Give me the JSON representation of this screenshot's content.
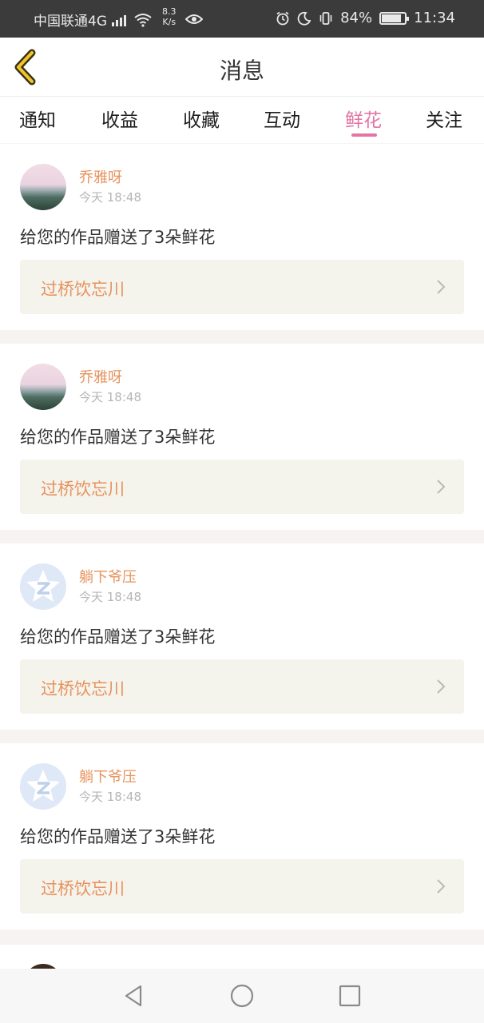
{
  "status_bar": {
    "carrier": "中国联通4G",
    "network_small": "4G",
    "speed_value": "8.3",
    "speed_unit": "K/s",
    "battery": "84%",
    "time": "11:34"
  },
  "header": {
    "title": "消息",
    "back_icon": "chevron-left-icon"
  },
  "tabs": [
    {
      "label": "通知",
      "active": false
    },
    {
      "label": "收益",
      "active": false
    },
    {
      "label": "收藏",
      "active": false
    },
    {
      "label": "互动",
      "active": false
    },
    {
      "label": "鲜花",
      "active": true
    },
    {
      "label": "关注",
      "active": false
    }
  ],
  "colors": {
    "accent_pink": "#e275a4",
    "name_orange": "#e7925c",
    "card_bg": "#f4f3ec"
  },
  "messages": [
    {
      "user": "乔雅呀",
      "time": "今天 18:48",
      "text": "给您的作品赠送了3朵鲜花",
      "work_title": "过桥饮忘川",
      "avatar": "landscape-avatar"
    },
    {
      "user": "乔雅呀",
      "time": "今天 18:48",
      "text": "给您的作品赠送了3朵鲜花",
      "work_title": "过桥饮忘川",
      "avatar": "landscape-avatar"
    },
    {
      "user": "躺下爷压",
      "time": "今天 18:48",
      "text": "给您的作品赠送了3朵鲜花",
      "work_title": "过桥饮忘川",
      "avatar": "star-logo-avatar"
    },
    {
      "user": "躺下爷压",
      "time": "今天 18:48",
      "text": "给您的作品赠送了3朵鲜花",
      "work_title": "过桥饮忘川",
      "avatar": "star-logo-avatar"
    }
  ],
  "nav_bar": {
    "back": "triangle-back-icon",
    "home": "circle-home-icon",
    "recents": "square-recents-icon"
  }
}
